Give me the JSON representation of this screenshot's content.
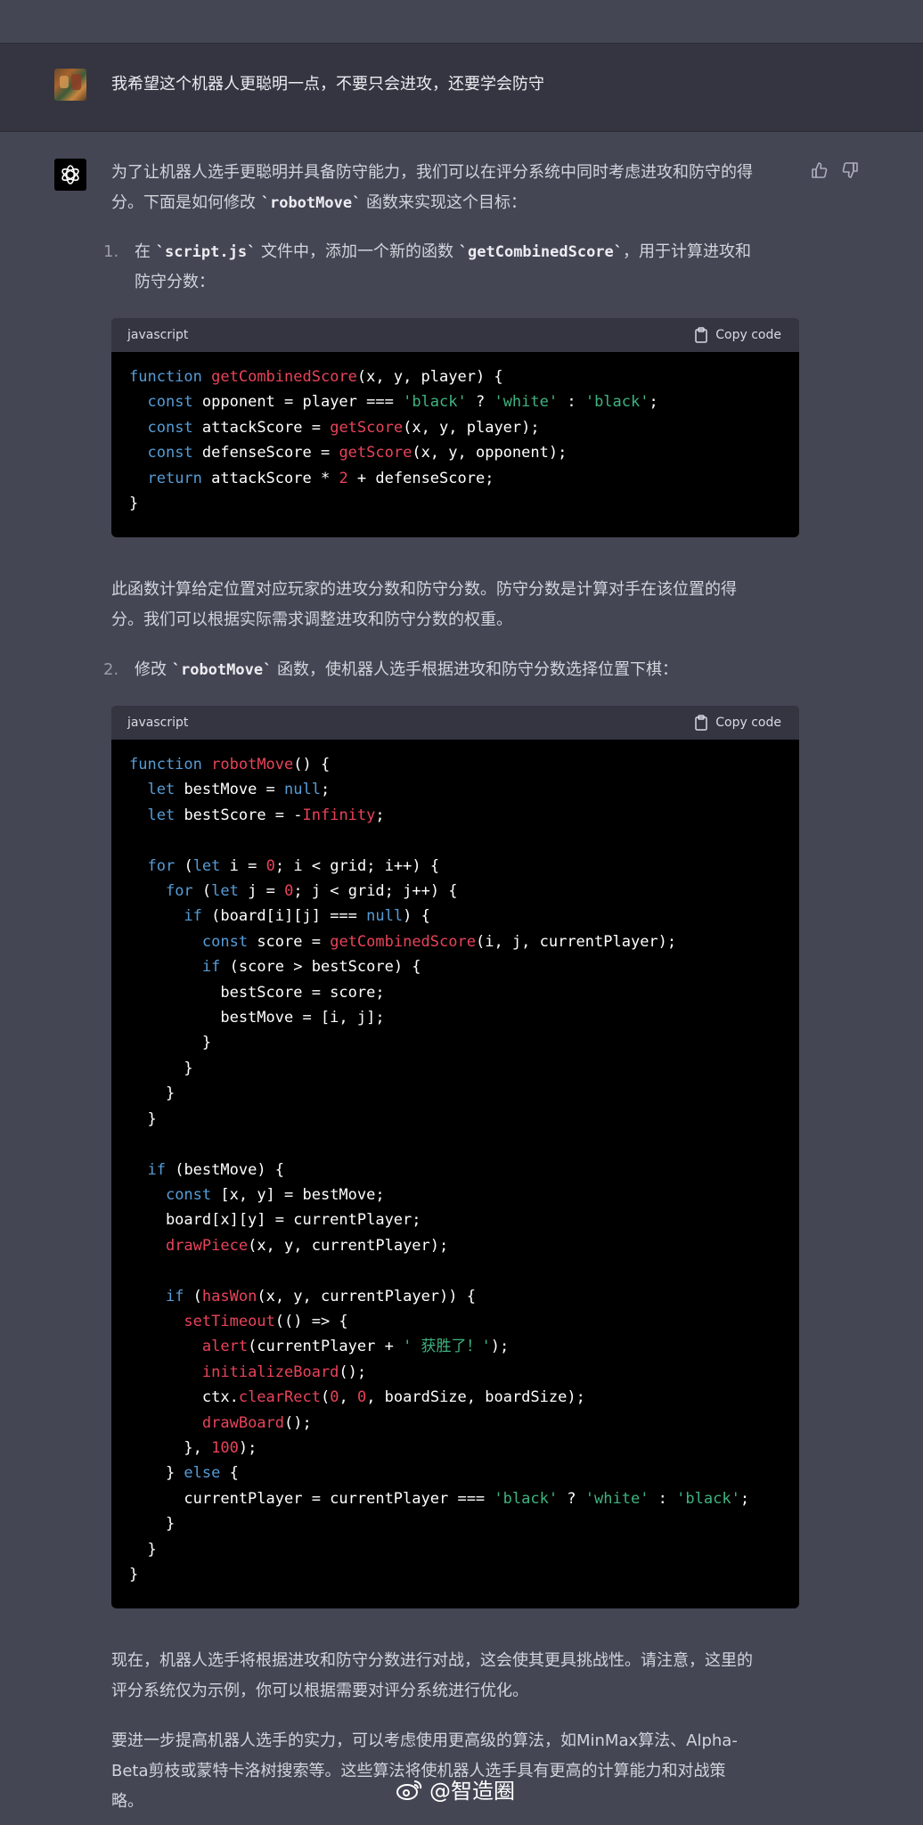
{
  "user_message": {
    "text": "我希望这个机器人更聪明一点，不要只会进攻，还要学会防守"
  },
  "assistant": {
    "intro_line1_a": "为了让机器人选手更聪明并具备防守能力，我们可以在评分系统中同时考虑进攻和防守的得",
    "intro_line2_a": "分。下面是如何修改 ",
    "intro_code": "`robotMove`",
    "intro_line2_b": " 函数来实现这个目标：",
    "step1": {
      "number": "1.",
      "line1_a": "在 ",
      "code1": "`script.js`",
      "line1_b": " 文件中，添加一个新的函数 ",
      "code2": "`getCombinedScore`",
      "line1_c": "，用于计算进攻和",
      "line2": "防守分数："
    },
    "code_block_1": {
      "language": "javascript",
      "copy_label": "Copy code"
    },
    "explain_line1": "此函数计算给定位置对应玩家的进攻分数和防守分数。防守分数是计算对手在该位置的得",
    "explain_line2": "分。我们可以根据实际需求调整进攻和防守分数的权重。",
    "step2": {
      "number": "2.",
      "line_a": "修改 ",
      "code": "`robotMove`",
      "line_b": " 函数，使机器人选手根据进攻和防守分数选择位置下棋："
    },
    "code_block_2": {
      "language": "javascript",
      "copy_label": "Copy code"
    },
    "closing1_line1": "现在，机器人选手将根据进攻和防守分数进行对战，这会使其更具挑战性。请注意，这里的",
    "closing1_line2": "评分系统仅为示例，你可以根据需要对评分系统进行优化。",
    "closing2_line1": "要进一步提高机器人选手的实力，可以考虑使用更高级的算法，如MinMax算法、Alpha-",
    "closing2_line2": "Beta剪枝或蒙特卡洛树搜索等。这些算法将使机器人选手具有更高的计算能力和对战策",
    "closing2_line3": "略。"
  },
  "watermark": "@智造圈",
  "colors": {
    "background": "#444654",
    "user_row": "#343541",
    "code_bg": "#000000",
    "keyword": "#569cd6",
    "function": "#e9435a",
    "string": "#3fb37f"
  }
}
